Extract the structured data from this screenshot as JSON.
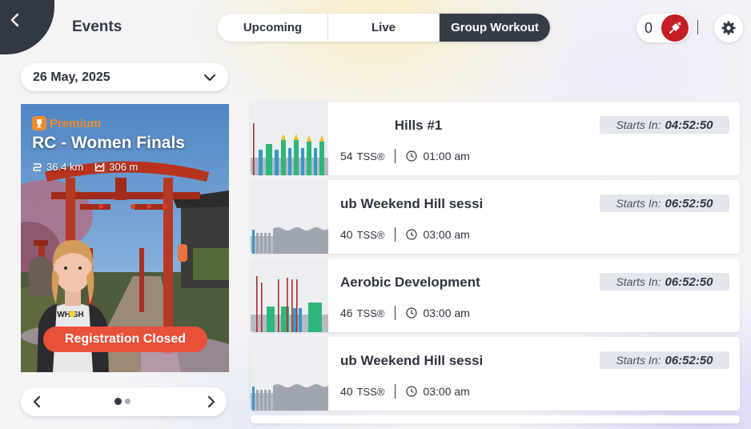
{
  "header": {
    "title": "Events",
    "tabs": [
      {
        "label": "Upcoming",
        "active": false
      },
      {
        "label": "Live",
        "active": false
      },
      {
        "label": "Group Workout",
        "active": true
      }
    ],
    "coin_count": "0",
    "icons": {
      "back": "chevron-left-icon",
      "energy": "power-plug-icon",
      "settings": "gear-icon"
    },
    "colors": {
      "accent_dark": "#363b48",
      "energy_red": "#c51d24",
      "premium_orange": "#f08a2c",
      "badge_red": "#e8503a"
    }
  },
  "date_filter": {
    "value": "26 May, 2025"
  },
  "featured": {
    "tier": "Premium",
    "title": "RC - Women Finals",
    "distance": "36.4 km",
    "elevation": "306 m",
    "status": "Registration Closed",
    "jersey_text": "WH SH",
    "carousel": {
      "pages": 2,
      "current": 1
    }
  },
  "events": [
    {
      "name": "Hills #1",
      "starts_label": "Starts In:",
      "starts_in": "04:52:50",
      "tss": "54",
      "tss_unit": "TSS®",
      "time": "01:00 am"
    },
    {
      "name": "ub Weekend Hill sessi",
      "starts_label": "Starts In:",
      "starts_in": "06:52:50",
      "tss": "40",
      "tss_unit": "TSS®",
      "time": "03:00 am"
    },
    {
      "name": "Aerobic Development",
      "starts_label": "Starts In:",
      "starts_in": "06:52:50",
      "tss": "46",
      "tss_unit": "TSS®",
      "time": "03:00 am"
    },
    {
      "name": "ub Weekend Hill sessi",
      "starts_label": "Starts In:",
      "starts_in": "06:52:50",
      "tss": "40",
      "tss_unit": "TSS®",
      "time": "03:00 am"
    }
  ]
}
